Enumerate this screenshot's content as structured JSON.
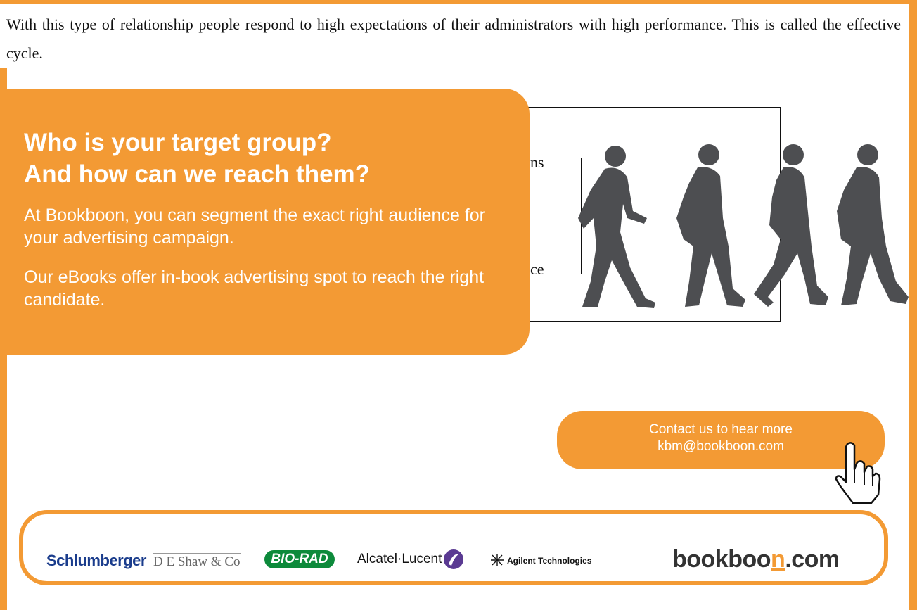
{
  "document": {
    "paragraph": "With this type of relationship people respond to high expectations of their administrators with high performance. This is called the effective cycle."
  },
  "diagram_fragments": {
    "label_a": "ns",
    "label_b": "ce"
  },
  "ad": {
    "headline_line1": "Who is your target group?",
    "headline_line2": "And how can we reach them?",
    "body1": "At Bookboon, you can segment the exact right audience for your advertising campaign.",
    "body2": "Our eBooks offer in-book advertising spot to reach the right candidate.",
    "contact_line1": "Contact us to hear more",
    "contact_line2": "kbm@bookboon.com",
    "accent_color": "#f39a34",
    "silhouette_color": "#4d4e51"
  },
  "logos": {
    "schlumberger": "Schlumberger",
    "deshaw": "D E Shaw & Co",
    "biorad": "BIO-RAD",
    "alcatel": "Alcatel·Lucent",
    "agilent": "Agilent Technologies",
    "bookboon_pre": "bookboo",
    "bookboon_n": "n",
    "bookboon_post": ".com"
  }
}
